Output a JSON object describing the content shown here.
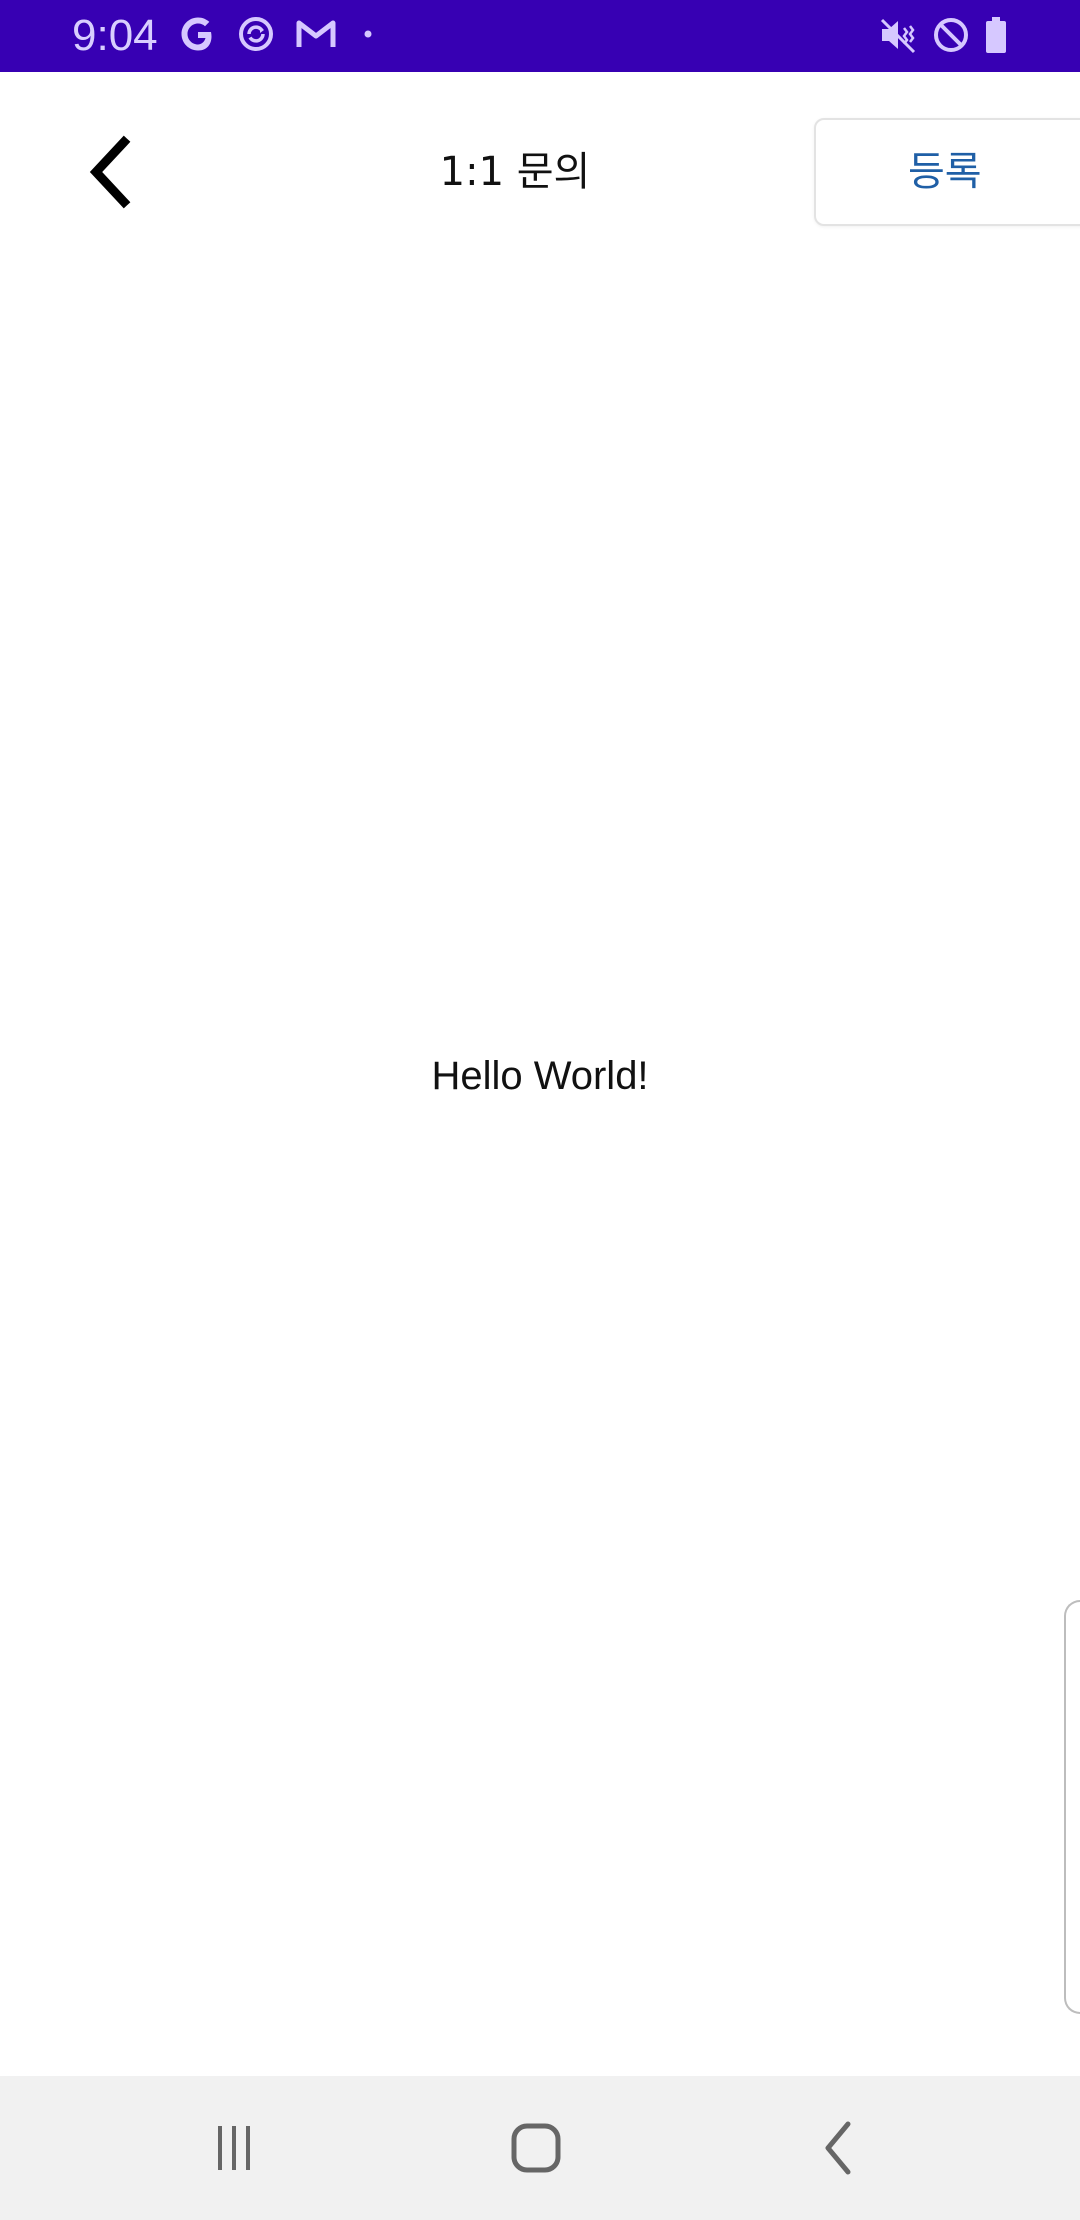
{
  "status_bar": {
    "time": "9:04",
    "left_icons": [
      "google-icon",
      "sync-icon",
      "gmail-icon",
      "dot-icon"
    ],
    "right_icons": [
      "mute-icon",
      "do-not-disturb-icon",
      "battery-icon"
    ],
    "background": "#3700b3"
  },
  "app_bar": {
    "back_icon": "chevron-left-icon",
    "title": "1:1 문의",
    "register_label": "등록",
    "register_color": "#1f5fa6"
  },
  "content": {
    "text": "Hello World!"
  },
  "nav_bar": {
    "icons": [
      "recents-icon",
      "home-icon",
      "back-icon"
    ]
  }
}
